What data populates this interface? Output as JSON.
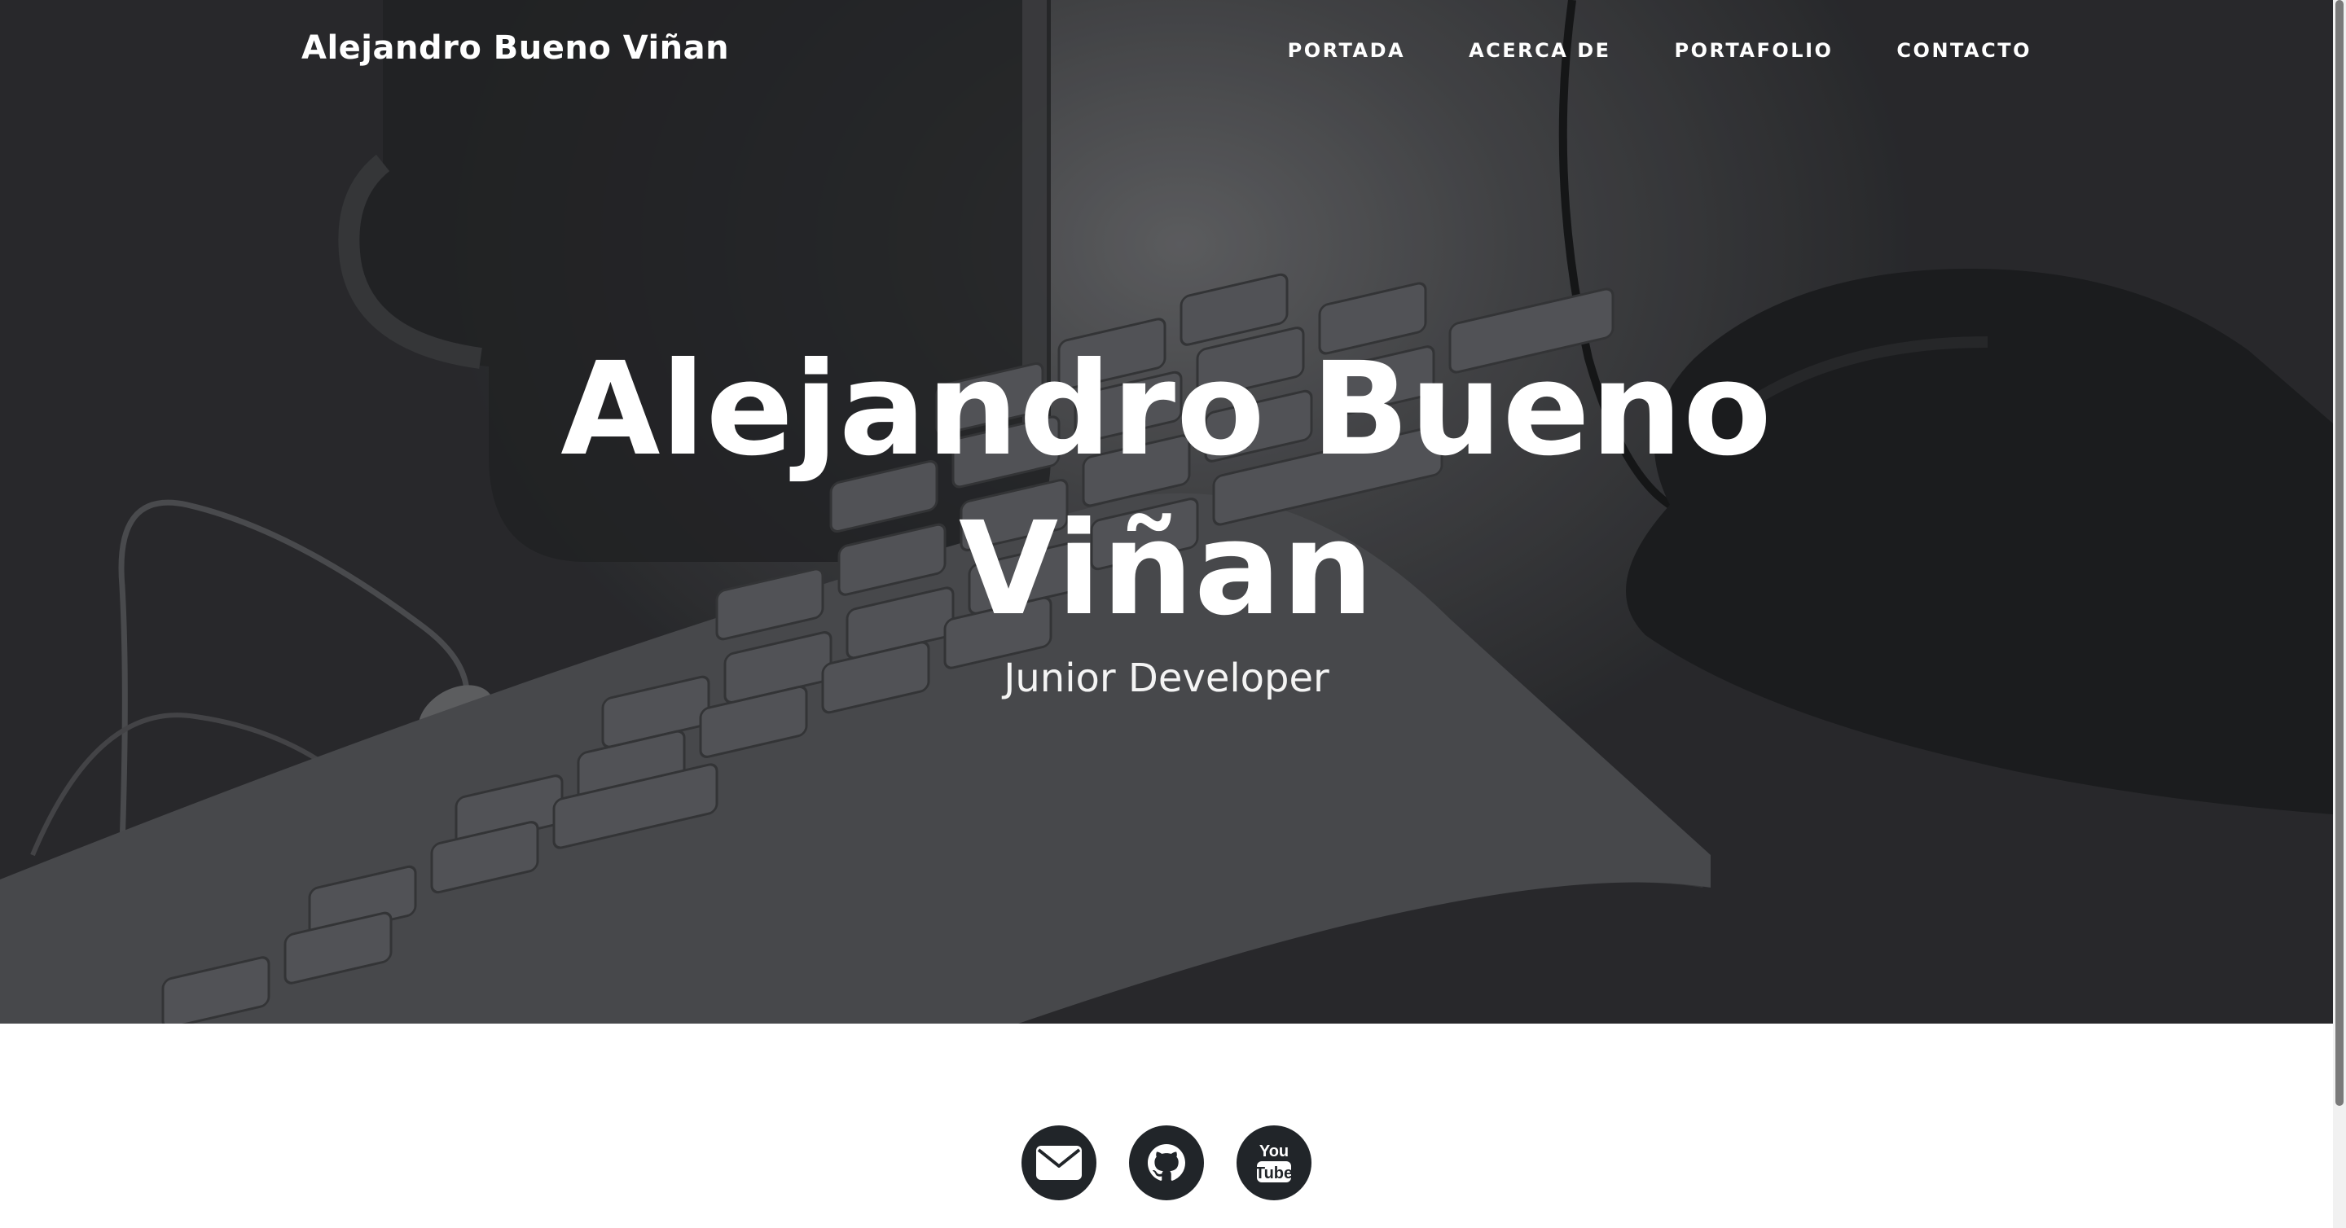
{
  "navbar": {
    "brand": "Alejandro Bueno Viñan",
    "links": [
      {
        "label": "PORTADA"
      },
      {
        "label": "ACERCA DE"
      },
      {
        "label": "PORTAFOLIO"
      },
      {
        "label": "CONTACTO"
      }
    ]
  },
  "hero": {
    "title": "Alejandro Bueno Viñan",
    "subtitle": "Junior Developer",
    "background_icon": "desk-keyboard-mouse-photo"
  },
  "social": {
    "items": [
      {
        "icon": "envelope-icon"
      },
      {
        "icon": "github-icon"
      },
      {
        "icon": "youtube-icon",
        "text_top": "You",
        "text_bottom": "Tube"
      }
    ]
  },
  "colors": {
    "social_bg": "#212529",
    "hero_dark": "#2c2d30",
    "text_light": "#ffffff"
  }
}
